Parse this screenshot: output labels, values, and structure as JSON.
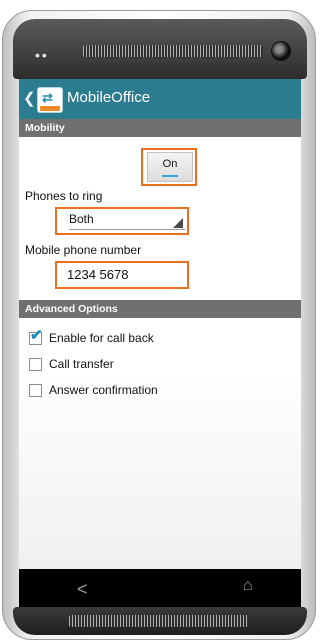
{
  "app": {
    "title": "MobileOffice",
    "back_icon": "chevron-left-icon",
    "accent": "#2b7c8e"
  },
  "mobility": {
    "header": "Mobility",
    "toggle_label": "On",
    "phones_to_ring_label": "Phones to ring",
    "phones_to_ring_value": "Both",
    "mobile_number_label": "Mobile phone number",
    "mobile_number_value": "1234 5678"
  },
  "advanced": {
    "header": "Advanced Options",
    "options": [
      {
        "label": "Enable for call back",
        "checked": true
      },
      {
        "label": "Call transfer",
        "checked": false
      },
      {
        "label": "Answer confirmation",
        "checked": false
      }
    ]
  },
  "nav": {
    "back_glyph": "<",
    "home_glyph": "⌂"
  },
  "device": {
    "dots": "••"
  },
  "highlight_color": "#e8701f"
}
